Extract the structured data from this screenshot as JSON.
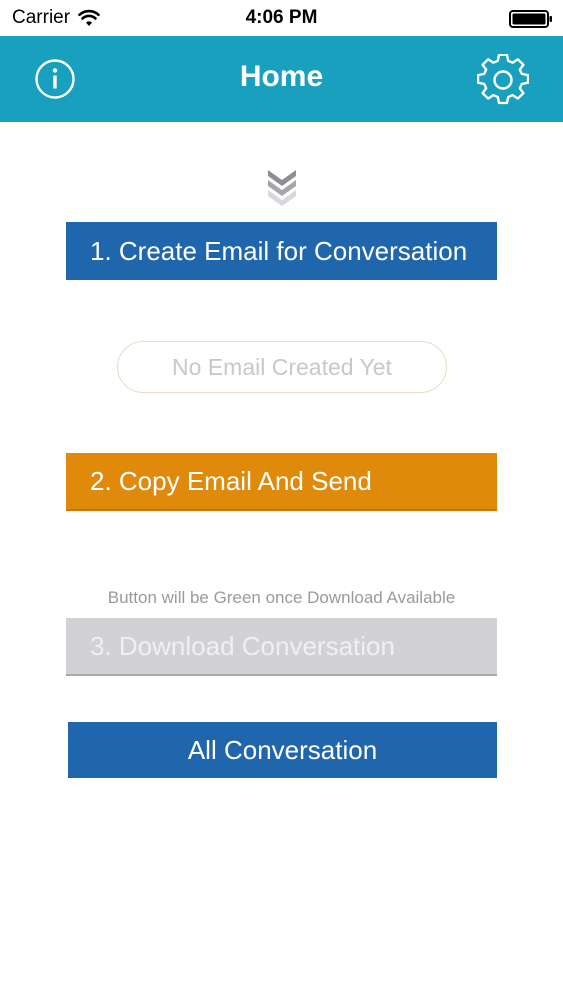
{
  "status_bar": {
    "carrier": "Carrier",
    "time": "4:06 PM"
  },
  "nav": {
    "title": "Home",
    "left_icon": "info-icon",
    "right_icon": "gear-icon",
    "background_color": "#1aa0bf"
  },
  "main": {
    "create_email_label": "1. Create Email for Conversation",
    "email_placeholder": "No Email Created Yet",
    "copy_send_label": "2. Copy Email And Send",
    "hint": "Button will be Green once Download Available",
    "download_label": "3. Download Conversation",
    "all_conversation_label": "All Conversation"
  },
  "colors": {
    "primary_blue": "#1f66ad",
    "orange": "#e08a0c",
    "disabled_gray": "#d2d2d4"
  }
}
